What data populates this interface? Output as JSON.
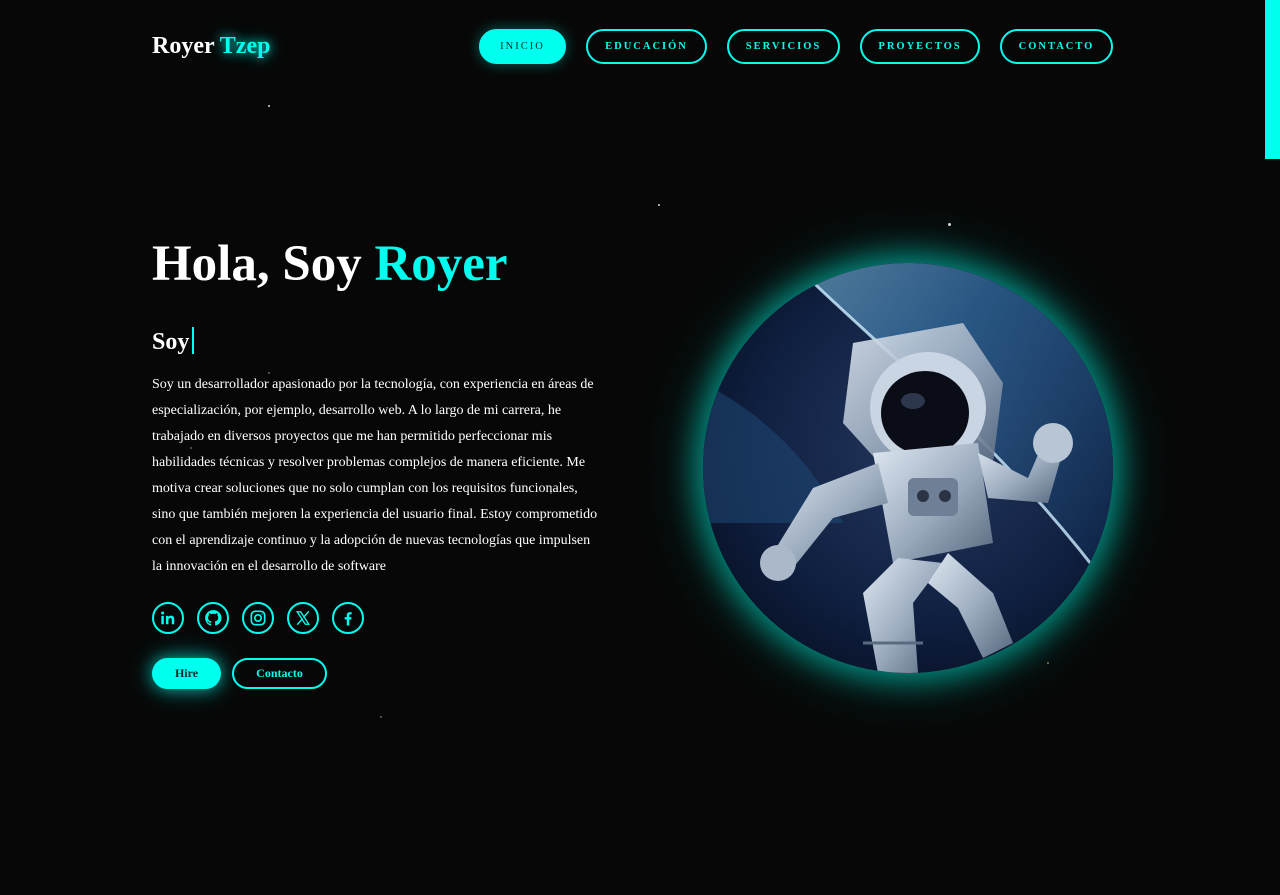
{
  "header": {
    "logo_first": "Royer",
    "logo_second": "Tzep",
    "nav": [
      {
        "label": "INICIO",
        "active": true
      },
      {
        "label": "EDUCACIÓN",
        "active": false
      },
      {
        "label": "SERVICIOS",
        "active": false
      },
      {
        "label": "PROYECTOS",
        "active": false
      },
      {
        "label": "CONTACTO",
        "active": false
      }
    ]
  },
  "hero": {
    "greeting": "Hola, Soy",
    "name": "Royer",
    "typed_prefix": "Soy",
    "bio": "Soy un desarrollador apasionado por la tecnología, con experiencia en áreas de especialización, por ejemplo, desarrollo web. A lo largo de mi carrera, he trabajado en diversos proyectos que me han permitido perfeccionar mis habilidades técnicas y resolver problemas complejos de manera eficiente. Me motiva crear soluciones que no solo cumplan con los requisitos funcionales, sino que también mejoren la experiencia del usuario final. Estoy comprometido con el aprendizaje continuo y la adopción de nuevas tecnologías que impulsen la innovación en el desarrollo de software",
    "socials": [
      "linkedin-icon",
      "github-icon",
      "instagram-icon",
      "x-icon",
      "facebook-icon"
    ],
    "hire_label": "Hire",
    "contact_label": "Contacto",
    "image": "astronaut-in-space"
  },
  "colors": {
    "accent": "#00ffee",
    "background": "#070707",
    "text": "#ffffff"
  }
}
